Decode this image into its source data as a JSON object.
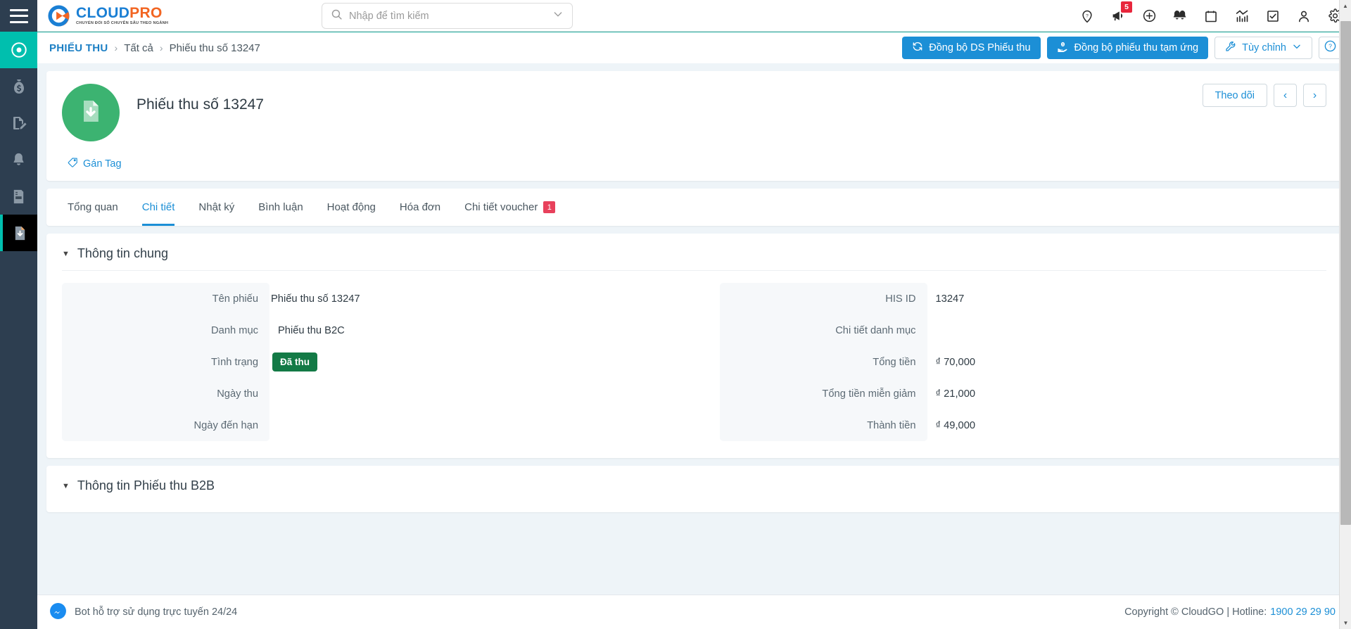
{
  "brand": {
    "name_part1": "CLOUD",
    "name_part2": "PRO",
    "tagline": "CHUYỂN ĐỔI SỐ CHUYÊN SÂU THEO NGÀNH",
    "logo_blue": "#1a7fd4",
    "logo_orange": "#f26522"
  },
  "search": {
    "placeholder": "Nhập để tìm kiếm",
    "value": ""
  },
  "topbar_icons": [
    {
      "name": "location-help-icon",
      "badge": ""
    },
    {
      "name": "megaphone-icon",
      "badge": "5"
    },
    {
      "name": "plus-circle-icon",
      "badge": ""
    },
    {
      "name": "bells-icon",
      "badge": ""
    },
    {
      "name": "calendar-icon",
      "badge": ""
    },
    {
      "name": "analytics-icon",
      "badge": ""
    },
    {
      "name": "checkbox-task-icon",
      "badge": ""
    },
    {
      "name": "user-icon",
      "badge": ""
    },
    {
      "name": "gear-icon",
      "badge": ""
    }
  ],
  "sidebar": {
    "items": [
      {
        "name": "target-icon",
        "state": "active-teal"
      },
      {
        "name": "money-bag-icon",
        "state": ""
      },
      {
        "name": "document-edit-icon",
        "state": ""
      },
      {
        "name": "bell-icon",
        "state": ""
      },
      {
        "name": "document-list-icon",
        "state": ""
      },
      {
        "name": "document-download-icon",
        "state": "active-dark"
      }
    ]
  },
  "breadcrumb": {
    "root": "PHIẾU THU",
    "separator": "›",
    "middle": "Tất cả",
    "current": "Phiếu thu số 13247"
  },
  "actions": {
    "sync_list": "Đồng bộ DS Phiếu thu",
    "sync_advance": "Đồng bộ phiếu thu tạm ứng",
    "customize": "Tùy chỉnh",
    "help_icon": "question-circle-icon"
  },
  "record": {
    "title": "Phiếu thu số 13247",
    "tag_action": "Gán Tag",
    "follow": "Theo dõi",
    "prev": "‹",
    "next": "›",
    "avatar_color": "#3cb371"
  },
  "tabs": [
    {
      "label": "Tổng quan",
      "active": false,
      "badge": ""
    },
    {
      "label": "Chi tiết",
      "active": true,
      "badge": ""
    },
    {
      "label": "Nhật ký",
      "active": false,
      "badge": ""
    },
    {
      "label": "Bình luận",
      "active": false,
      "badge": ""
    },
    {
      "label": "Hoạt động",
      "active": false,
      "badge": ""
    },
    {
      "label": "Hóa đơn",
      "active": false,
      "badge": ""
    },
    {
      "label": "Chi tiết voucher",
      "active": false,
      "badge": "1"
    }
  ],
  "sections": {
    "general": {
      "title": "Thông tin chung",
      "left_fields": [
        {
          "label": "Tên phiếu",
          "value": "Phiếu thu số 13247",
          "type": "text"
        },
        {
          "label": "Danh mục",
          "value": "Phiếu thu B2C",
          "type": "link"
        },
        {
          "label": "Tình trạng",
          "value": "Đã thu",
          "type": "status",
          "color": "#137a46"
        },
        {
          "label": "Ngày thu",
          "value": "",
          "type": "text"
        },
        {
          "label": "Ngày đến hạn",
          "value": "",
          "type": "text"
        }
      ],
      "right_fields": [
        {
          "label": "HIS ID",
          "value": "13247",
          "type": "text"
        },
        {
          "label": "Chi tiết danh mục",
          "value": "",
          "type": "text"
        },
        {
          "label": "Tổng tiền",
          "value": "₫ 70,000",
          "type": "text"
        },
        {
          "label": "Tổng tiền miễn giảm",
          "value": "₫ 21,000",
          "type": "text"
        },
        {
          "label": "Thành tiền",
          "value": "₫ 49,000",
          "type": "text"
        }
      ]
    },
    "b2b": {
      "title": "Thông tin Phiếu thu B2B"
    }
  },
  "footer": {
    "bot_text": "Bot hỗ trợ sử dụng trực tuyến 24/24",
    "copyright": "Copyright © CloudGO",
    "divider": "|",
    "hotline_label": "Hotline:",
    "hotline_number": "1900 29 29 90"
  }
}
